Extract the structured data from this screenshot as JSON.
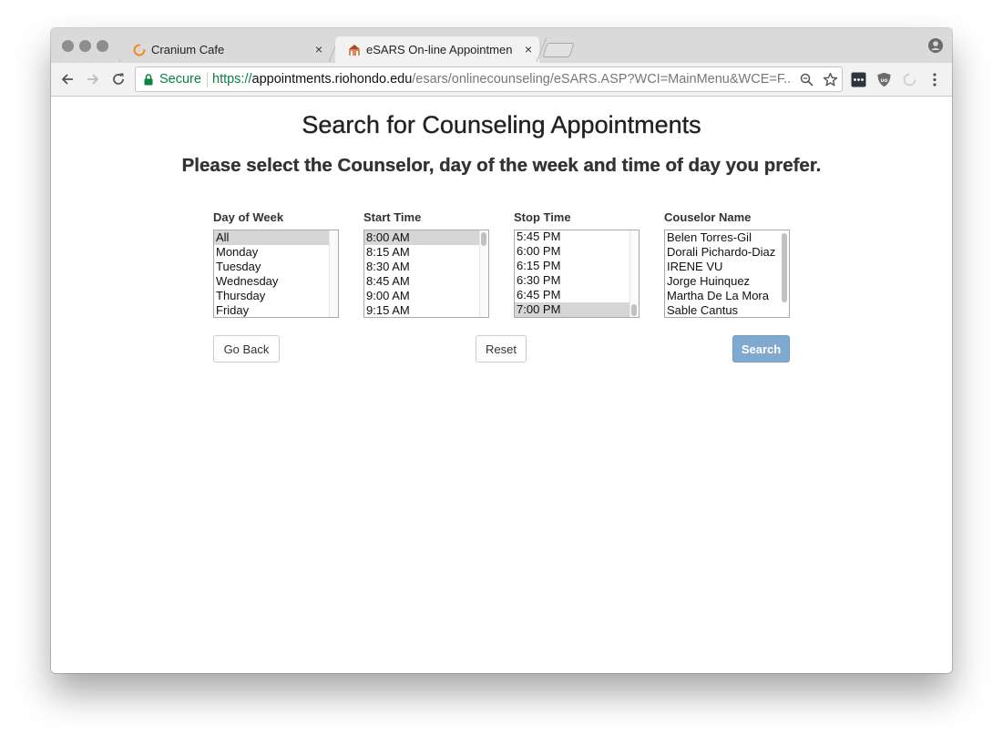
{
  "browser": {
    "tabs": [
      {
        "title": "Cranium Cafe",
        "close": "×"
      },
      {
        "title": "eSARS On-line Appointment S",
        "close": "×"
      }
    ],
    "omnibox": {
      "secure_label": "Secure",
      "url_scheme": "https://",
      "url_host": "appointments.riohondo.edu",
      "url_path": "/esars/onlinecounseling/eSARS.ASP?WCI=MainMenu&WCE=F..."
    },
    "colors": {
      "secure": "#0b8043",
      "loading_spinner": "#f28a1e"
    }
  },
  "page": {
    "title": "Search for Counseling Appointments",
    "subtitle": "Please select the Counselor, day of the week and time of day you prefer.",
    "fields": [
      {
        "label": "Day of Week",
        "options": [
          "All",
          "Monday",
          "Tuesday",
          "Wednesday",
          "Thursday",
          "Friday"
        ],
        "selected": "All"
      },
      {
        "label": "Start Time",
        "options": [
          "8:00 AM",
          "8:15 AM",
          "8:30 AM",
          "8:45 AM",
          "9:00 AM",
          "9:15 AM"
        ],
        "selected": "8:00 AM"
      },
      {
        "label": "Stop Time",
        "options": [
          "5:45 PM",
          "6:00 PM",
          "6:15 PM",
          "6:30 PM",
          "6:45 PM",
          "7:00 PM"
        ],
        "selected": "7:00 PM"
      },
      {
        "label": "Couselor Name",
        "options": [
          "Belen Torres-Gil",
          "Dorali Pichardo-Diaz",
          "IRENE VU",
          "Jorge Huinquez",
          "Martha De La Mora",
          "Sable Cantus"
        ],
        "selected": ""
      }
    ],
    "buttons": {
      "back": "Go Back",
      "reset": "Reset",
      "search": "Search"
    },
    "colors": {
      "search_button": "#7fa9cf",
      "selected_option": "#d6d6d6"
    }
  }
}
